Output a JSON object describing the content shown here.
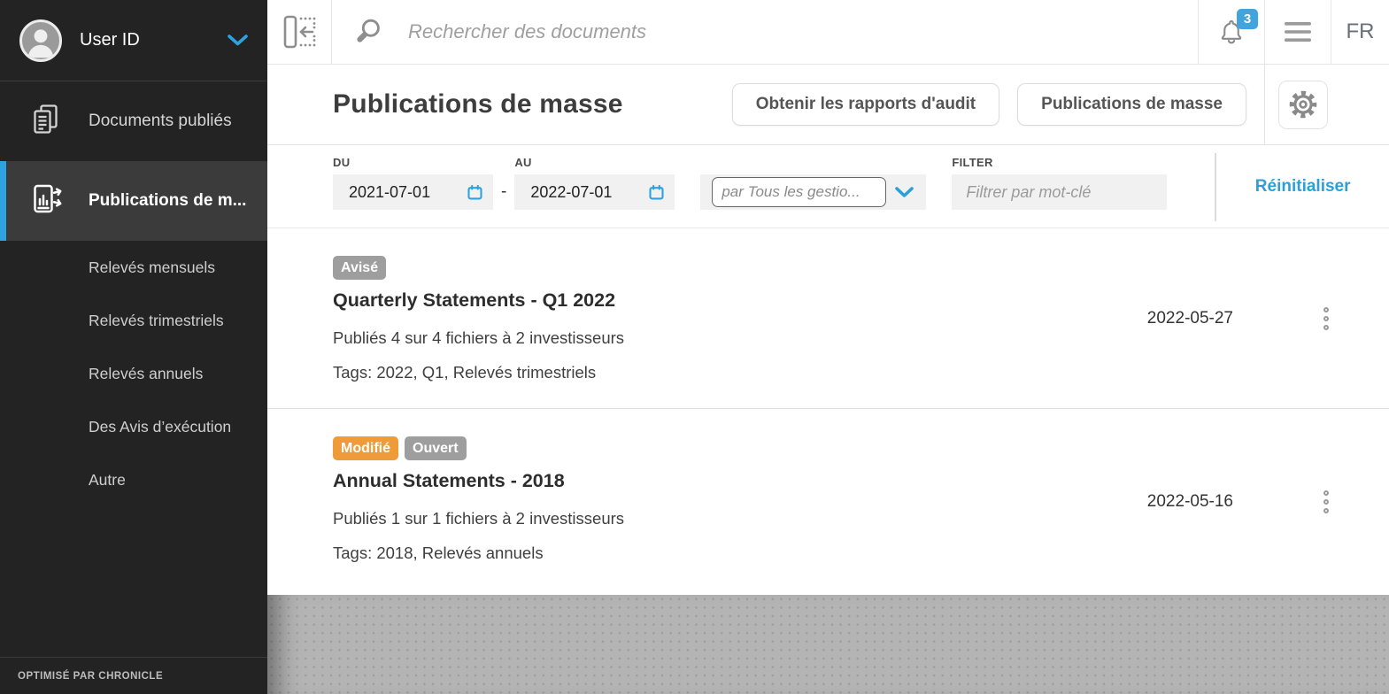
{
  "colors": {
    "accent": "#2ea2e0",
    "link": "#2d9fd8",
    "notification": "#42a4dc",
    "badge-gray": "#9e9e9e",
    "badge-orange": "#ef9b3a"
  },
  "sidebar": {
    "user": {
      "name": "User ID"
    },
    "items": [
      {
        "label": "Documents publiés"
      },
      {
        "label": "Publications de m..."
      }
    ],
    "subitems": [
      "Relevés mensuels",
      "Relevés trimestriels",
      "Relevés annuels",
      "Des Avis d’exécution",
      "Autre"
    ],
    "footer": "OPTIMISÉ PAR CHRONICLE"
  },
  "topbar": {
    "search_placeholder": "Rechercher des documents",
    "notification_count": "3",
    "language": "FR"
  },
  "header": {
    "title": "Publications de masse",
    "buttons": [
      {
        "label": "Obtenir les rapports d'audit"
      },
      {
        "label": "Publications de masse"
      }
    ]
  },
  "filters": {
    "from_label": "DU",
    "from_value": "2021-07-01",
    "separator": "-",
    "to_label": "AU",
    "to_value": "2022-07-01",
    "manager_value": "par Tous les gestio...",
    "keyword_label": "FILTER",
    "keyword_placeholder": "Filtrer par mot-clé",
    "reset_label": "Réinitialiser"
  },
  "publications": [
    {
      "badges": [
        {
          "label": "Avisé",
          "type": "gray"
        }
      ],
      "title": "Quarterly Statements - Q1 2022",
      "detail": "Publiés 4 sur 4 fichiers à 2 investisseurs",
      "tags": "Tags: 2022, Q1, Relevés trimestriels",
      "date": "2022-05-27"
    },
    {
      "badges": [
        {
          "label": "Modifié",
          "type": "orange"
        },
        {
          "label": "Ouvert",
          "type": "gray"
        }
      ],
      "title": "Annual Statements - 2018",
      "detail": "Publiés 1 sur 1 fichiers à 2 investisseurs",
      "tags": "Tags: 2018, Relevés annuels",
      "date": "2022-05-16"
    }
  ]
}
